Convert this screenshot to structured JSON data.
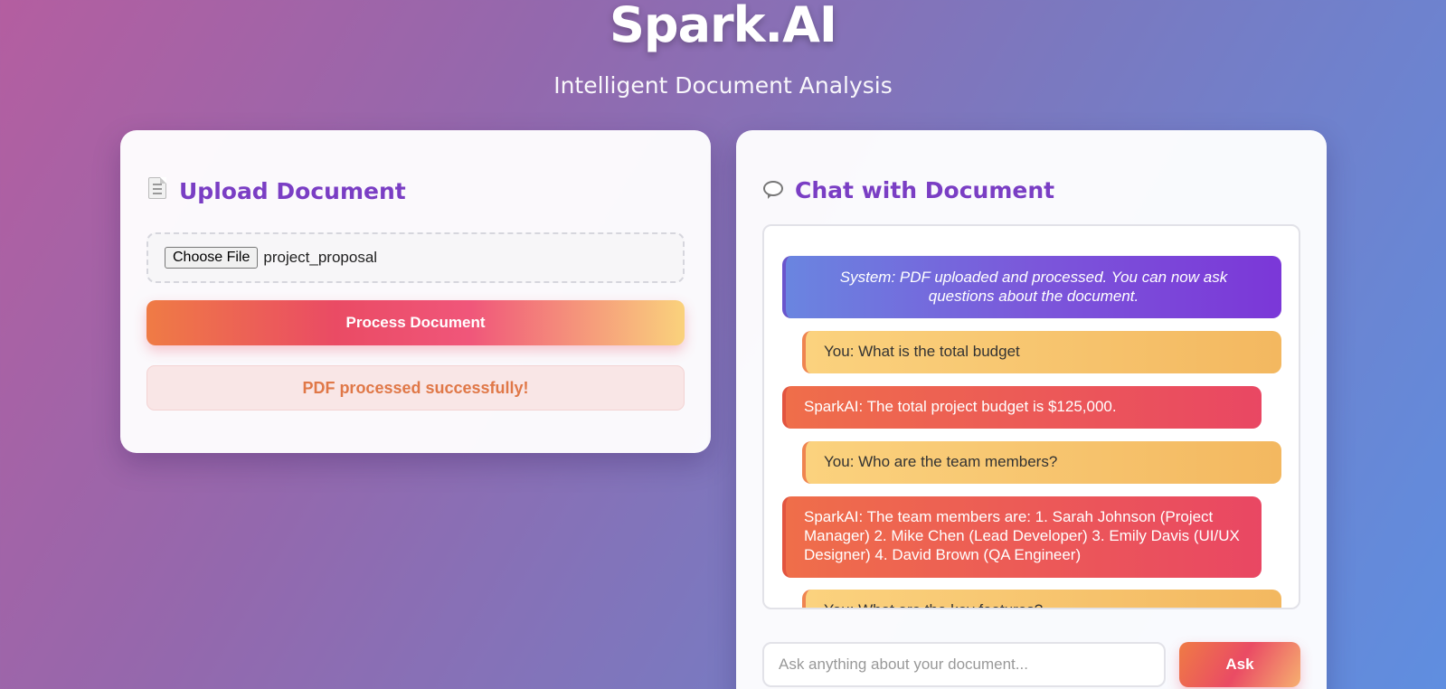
{
  "app": {
    "title": "Spark.AI",
    "subtitle": "Intelligent Document Analysis"
  },
  "upload": {
    "heading": "Upload Document",
    "heading_icon": "document-icon",
    "file_button_label": "Choose File",
    "file_name": "project_proposal",
    "process_button_label": "Process Document",
    "status_message": "PDF processed successfully!"
  },
  "chat": {
    "heading": "Chat with Document",
    "heading_icon": "speech-bubble-icon",
    "messages": [
      {
        "role": "system",
        "text": "System: PDF uploaded and processed. You can now ask questions about the document."
      },
      {
        "role": "user",
        "text": "You: What is the total budget"
      },
      {
        "role": "bot",
        "text": "SparkAI: The total project budget is $125,000."
      },
      {
        "role": "user",
        "text": "You: Who are the team members?"
      },
      {
        "role": "bot",
        "text": "SparkAI: The team members are: 1. Sarah Johnson (Project Manager) 2. Mike Chen (Lead Developer) 3. Emily Davis (UI/UX Designer) 4. David Brown (QA Engineer)"
      },
      {
        "role": "user",
        "text": "You: What are the key features?"
      }
    ],
    "input_placeholder": "Ask anything about your document...",
    "ask_button_label": "Ask"
  },
  "colors": {
    "heading": "#7a3ec4",
    "status_text": "#e07848",
    "user_bubble": "#f3b860",
    "bot_bubble": "#e94763",
    "system_bubble": "#7b37d8"
  }
}
